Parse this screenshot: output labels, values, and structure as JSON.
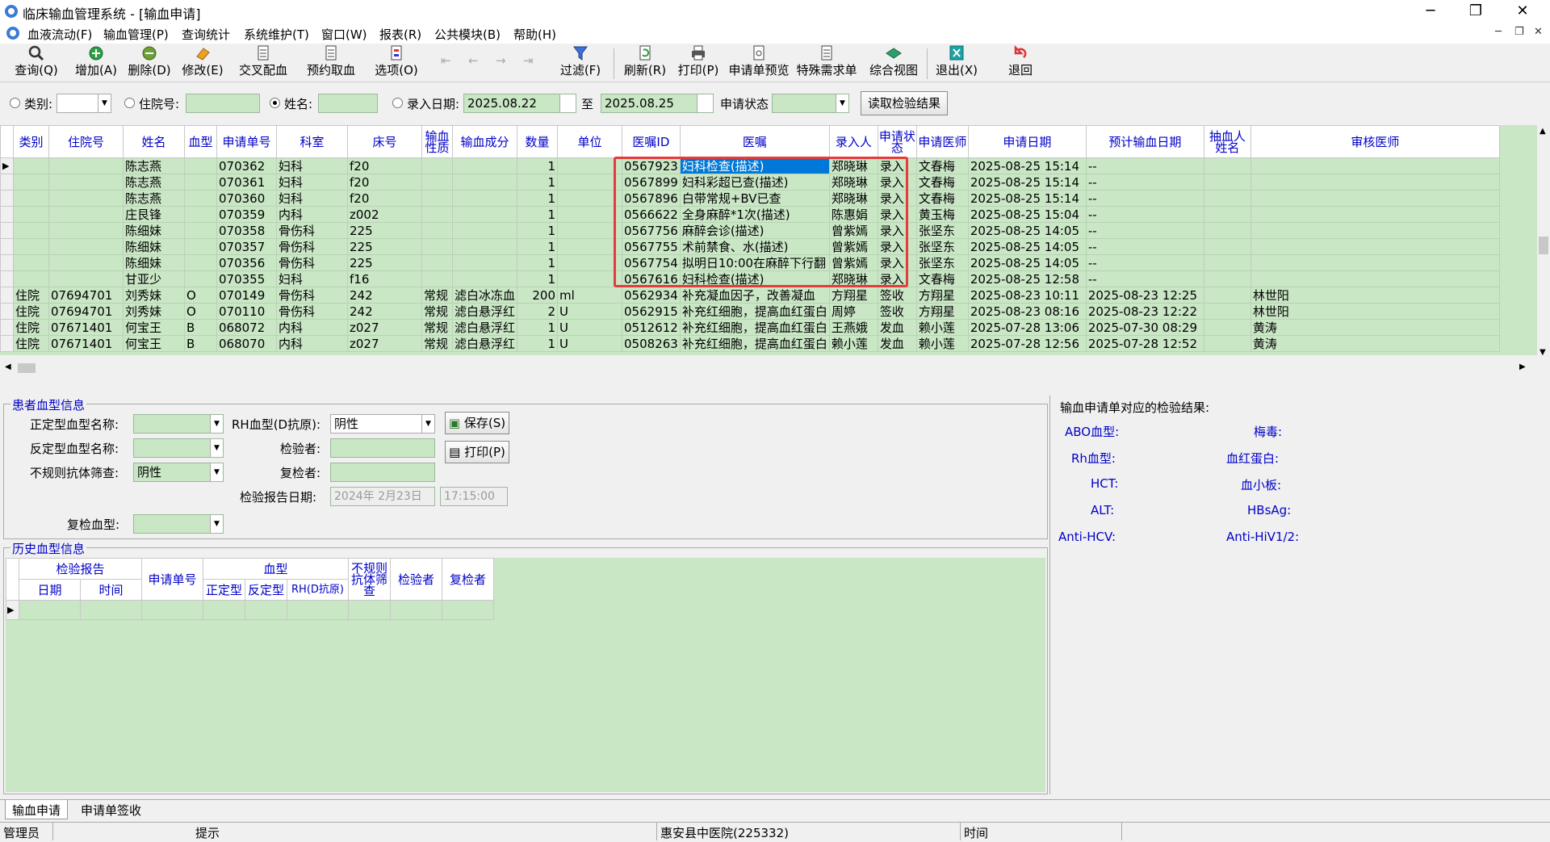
{
  "window": {
    "title": "临床输血管理系统 - [输血申请]",
    "controls": [
      "─",
      "❐",
      "✕"
    ]
  },
  "menu": {
    "items": [
      "血液流动(F)",
      "输血管理(P)",
      "查询统计",
      "系统维护(T)",
      "窗口(W)",
      "报表(R)",
      "公共模块(B)",
      "帮助(H)"
    ],
    "mdi_controls": [
      "─",
      "❐",
      "✕"
    ]
  },
  "toolbar": {
    "buttons": [
      {
        "label": "查询(Q)",
        "icon": "magnifier-icon"
      },
      {
        "label": "增加(A)",
        "icon": "plus-circle-icon"
      },
      {
        "label": "删除(D)",
        "icon": "minus-circle-icon"
      },
      {
        "label": "修改(E)",
        "icon": "eraser-icon"
      },
      {
        "label": "交叉配血",
        "icon": "document-icon"
      },
      {
        "label": "预约取血",
        "icon": "document-icon"
      },
      {
        "label": "选项(O)",
        "icon": "options-icon"
      },
      {
        "label": "过滤(F)",
        "icon": "filter-icon"
      },
      {
        "label": "刷新(R)",
        "icon": "refresh-icon"
      },
      {
        "label": "打印(P)",
        "icon": "printer-icon"
      },
      {
        "label": "申请单预览",
        "icon": "preview-icon"
      },
      {
        "label": "特殊需求单",
        "icon": "document-icon"
      },
      {
        "label": "综合视图",
        "icon": "book-icon"
      },
      {
        "label": "退出(X)",
        "icon": "exit-icon"
      },
      {
        "label": "退回",
        "icon": "return-icon"
      }
    ]
  },
  "filter": {
    "category_label": "类别:",
    "inpatient_no_label": "住院号:",
    "name_label": "姓名:",
    "entry_date_label": "录入日期:",
    "date_from": "2025.08.22",
    "to_label": "至",
    "date_to": "2025.08.25",
    "status_label": "申请状态",
    "read_results_button": "读取检验结果",
    "selected_radio": "name"
  },
  "grid": {
    "columns": [
      "类别",
      "住院号",
      "姓名",
      "血型",
      "申请单号",
      "科室",
      "床号",
      "输血性质",
      "输血成分",
      "数量",
      "单位",
      "医嘱ID",
      "医嘱",
      "录入人",
      "申请状态",
      "申请医师",
      "申请日期",
      "预计输血日期",
      "抽血人姓名",
      "审核医师"
    ],
    "rows": [
      [
        "",
        "",
        "陈志燕",
        "",
        "070362",
        "妇科",
        "f20",
        "",
        "",
        "1",
        "",
        "0567923",
        "妇科检查(描述)",
        "郑晓琳",
        "录入",
        "文春梅",
        "2025-08-25 15:14",
        "--",
        "",
        ""
      ],
      [
        "",
        "",
        "陈志燕",
        "",
        "070361",
        "妇科",
        "f20",
        "",
        "",
        "1",
        "",
        "0567899",
        "妇科彩超已查(描述)",
        "郑晓琳",
        "录入",
        "文春梅",
        "2025-08-25 15:14",
        "--",
        "",
        ""
      ],
      [
        "",
        "",
        "陈志燕",
        "",
        "070360",
        "妇科",
        "f20",
        "",
        "",
        "1",
        "",
        "0567896",
        "白带常规+BV已查",
        "郑晓琳",
        "录入",
        "文春梅",
        "2025-08-25 15:14",
        "--",
        "",
        ""
      ],
      [
        "",
        "",
        "庄艮锋",
        "",
        "070359",
        "内科",
        "z002",
        "",
        "",
        "1",
        "",
        "0566622",
        "全身麻醉*1次(描述)",
        "陈惠娟",
        "录入",
        "黄玉梅",
        "2025-08-25 15:04",
        "--",
        "",
        ""
      ],
      [
        "",
        "",
        "陈细妹",
        "",
        "070358",
        "骨伤科",
        "225",
        "",
        "",
        "1",
        "",
        "0567756",
        "麻醉会诊(描述)",
        "曾紫嫣",
        "录入",
        "张坚东",
        "2025-08-25 14:05",
        "--",
        "",
        ""
      ],
      [
        "",
        "",
        "陈细妹",
        "",
        "070357",
        "骨伤科",
        "225",
        "",
        "",
        "1",
        "",
        "0567755",
        "术前禁食、水(描述)",
        "曾紫嫣",
        "录入",
        "张坚东",
        "2025-08-25 14:05",
        "--",
        "",
        ""
      ],
      [
        "",
        "",
        "陈细妹",
        "",
        "070356",
        "骨伤科",
        "225",
        "",
        "",
        "1",
        "",
        "0567754",
        "拟明日10:00在麻醉下行翻",
        "曾紫嫣",
        "录入",
        "张坚东",
        "2025-08-25 14:05",
        "--",
        "",
        ""
      ],
      [
        "",
        "",
        "甘亚少",
        "",
        "070355",
        "妇科",
        "f16",
        "",
        "",
        "1",
        "",
        "0567616",
        "妇科检查(描述)",
        "郑晓琳",
        "录入",
        "文春梅",
        "2025-08-25 12:58",
        "--",
        "",
        ""
      ],
      [
        "住院",
        "07694701",
        "刘秀妹",
        "O",
        "070149",
        "骨伤科",
        "242",
        "常规",
        "滤白冰冻血",
        "200",
        "ml",
        "0562934",
        "补充凝血因子，改善凝血",
        "方翔星",
        "签收",
        "方翔星",
        "2025-08-23 10:11",
        "2025-08-23 12:25",
        "",
        "林世阳"
      ],
      [
        "住院",
        "07694701",
        "刘秀妹",
        "O",
        "070110",
        "骨伤科",
        "242",
        "常规",
        "滤白悬浮红",
        "2",
        "U",
        "0562915",
        "补充红细胞，提高血红蛋白",
        "周婷",
        "签收",
        "方翔星",
        "2025-08-23 08:16",
        "2025-08-23 12:22",
        "",
        "林世阳"
      ],
      [
        "住院",
        "07671401",
        "何宝王",
        "B",
        "068072",
        "内科",
        "z027",
        "常规",
        "滤白悬浮红",
        "1",
        "U",
        "0512612",
        "补充红细胞，提高血红蛋白",
        "王燕娥",
        "发血",
        "赖小莲",
        "2025-07-28 13:06",
        "2025-07-30 08:29",
        "",
        "黄涛"
      ],
      [
        "住院",
        "07671401",
        "何宝王",
        "B",
        "068070",
        "内科",
        "z027",
        "常规",
        "滤白悬浮红",
        "1",
        "U",
        "0508263",
        "补充红细胞，提高血红蛋白",
        "赖小莲",
        "发血",
        "赖小莲",
        "2025-07-28 12:56",
        "2025-07-28 12:52",
        "",
        "黄涛"
      ]
    ],
    "selected_row": 0
  },
  "patient_blood": {
    "group_title": "患者血型信息",
    "forward_type_label": "正定型血型名称:",
    "reverse_type_label": "反定型血型名称:",
    "irregular_antibody_label": "不规则抗体筛查:",
    "irregular_antibody_value": "阴性",
    "rh_label": "RH血型(D抗原):",
    "rh_value": "阴性",
    "tester_label": "检验者:",
    "rechecker_label": "复检者:",
    "report_date_label": "检验报告日期:",
    "report_date_value": "2024年 2月23日",
    "report_time_value": "17:15:00",
    "recheck_type_label": "复检血型:",
    "save_button": "保存(S)",
    "print_button": "打印(P)"
  },
  "history": {
    "group_title": "历史血型信息",
    "header_report": "检验报告",
    "header_date": "日期",
    "header_time": "时间",
    "header_apply_no": "申请单号",
    "header_blood_type": "血型",
    "header_forward": "正定型",
    "header_reverse": "反定型",
    "header_rh": "RH(D抗原)",
    "header_irregular": "不规则抗体筛查",
    "header_tester": "检验者",
    "header_rechecker": "复检者"
  },
  "results_panel": {
    "title": "输血申请单对应的检验结果:",
    "labels": [
      "ABO血型:",
      "梅毒:",
      "Rh血型:",
      "血红蛋白:",
      "HCT:",
      "血小板:",
      "ALT:",
      "HBsAg:",
      "Anti-HCV:",
      "Anti-HiV1/2:"
    ]
  },
  "tabs": [
    "输血申请",
    "申请单签收"
  ],
  "status_bar": {
    "user": "管理员",
    "hint": "提示",
    "hospital": "惠安县中医院(225332)",
    "time_label": "时间"
  },
  "colors": {
    "grid_bg": "#c9e6c5",
    "header_text": "#0000c8",
    "highlight_border": "#e53b3b",
    "selection": "#0078d7"
  }
}
